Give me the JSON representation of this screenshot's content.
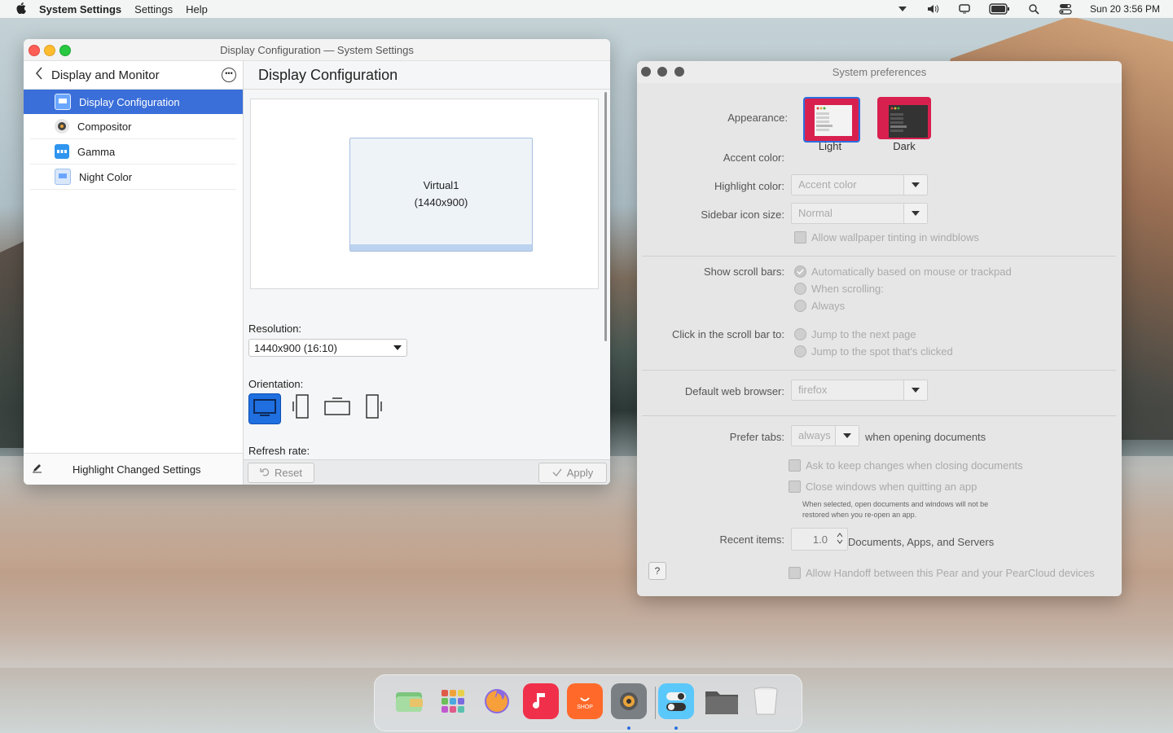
{
  "menubar": {
    "app_name": "System Settings",
    "menus": [
      "Settings",
      "Help"
    ],
    "clock": "Sun 20 3:56 PM"
  },
  "win1": {
    "title": "Display Configuration — System Settings",
    "sidebar": {
      "header": "Display and Monitor",
      "items": [
        {
          "label": "Display Configuration",
          "icon": "display-config-icon"
        },
        {
          "label": "Compositor",
          "icon": "compositor-icon"
        },
        {
          "label": "Gamma",
          "icon": "gamma-icon"
        },
        {
          "label": "Night Color",
          "icon": "night-color-icon"
        }
      ],
      "footer": "Highlight Changed Settings"
    },
    "main": {
      "title": "Display Configuration",
      "monitor_name": "Virtual1",
      "monitor_res": "(1440x900)",
      "resolution_label": "Resolution:",
      "resolution_value": "1440x900 (16:10)",
      "orientation_label": "Orientation:",
      "refresh_label": "Refresh rate:",
      "reset": "Reset",
      "apply": "Apply"
    }
  },
  "win2": {
    "title": "System preferences",
    "appearance_label": "Appearance:",
    "theme_light": "Light",
    "theme_dark": "Dark",
    "accent_label": "Accent color:",
    "highlight_label": "Highlight color:",
    "highlight_value": "Accent color",
    "sidebar_size_label": "Sidebar icon size:",
    "sidebar_size_value": "Normal",
    "wallpaper_tint": "Allow wallpaper tinting in windblows",
    "scroll_label": "Show scroll bars:",
    "scroll_opts": [
      "Automatically based on mouse or trackpad",
      "When scrolling:",
      "Always"
    ],
    "click_label": "Click in the scroll bar to:",
    "click_opts": [
      "Jump to the next page",
      "Jump to the spot that's clicked"
    ],
    "browser_label": "Default web browser:",
    "browser_value": "firefox",
    "tabs_label": "Prefer tabs:",
    "tabs_value": "always",
    "tabs_suffix": "when opening documents",
    "ask_keep": "Ask to keep changes when closing documents",
    "close_windows": "Close windows when quitting an app",
    "note": "When selected, open documents and windows will not be restored when you re-open an app.",
    "recent_label": "Recent items:",
    "recent_value": "1.0",
    "recent_suffix": "Documents, Apps, and Servers",
    "handoff": "Allow Handoff between this Pear and your PearCloud devices",
    "help": "?"
  },
  "dock": {
    "apps": [
      "files-manager-icon",
      "launcher-icon",
      "firefox-icon",
      "music-icon",
      "shop-icon",
      "settings-icon",
      "preferences-icon",
      "folder-icon",
      "trash-icon"
    ],
    "shop_label": "SHOP"
  }
}
